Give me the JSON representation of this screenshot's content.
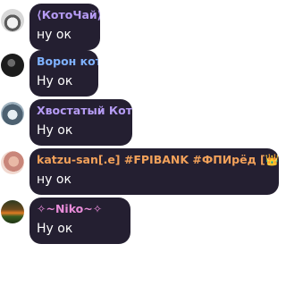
{
  "colors": {
    "bubble": "#241f31",
    "name1": "#b69cf5",
    "name2": "#7fb2ff",
    "name3": "#b69cf5",
    "name4": "#f2a15a",
    "name5": "#e98cd9",
    "text": "#ffffff"
  },
  "messages": [
    {
      "author": "⟨КотоЧай⟩",
      "text": "ну ок",
      "avatar": "cat-avatar"
    },
    {
      "author": "Ворон кот",
      "text": "Ну ок",
      "avatar": "dark-avatar"
    },
    {
      "author": "Хвостатый Котя",
      "text": "Ну ок",
      "avatar": "kitten-avatar"
    },
    {
      "author": "katzu-san[.e] #FPIBANK #ФПИрёд [👑✨❌...",
      "text": "ну ок",
      "avatar": "pink-avatar"
    },
    {
      "author": "✧~Niko~✧",
      "text": "Ну ок",
      "avatar": "sunset-avatar"
    }
  ]
}
